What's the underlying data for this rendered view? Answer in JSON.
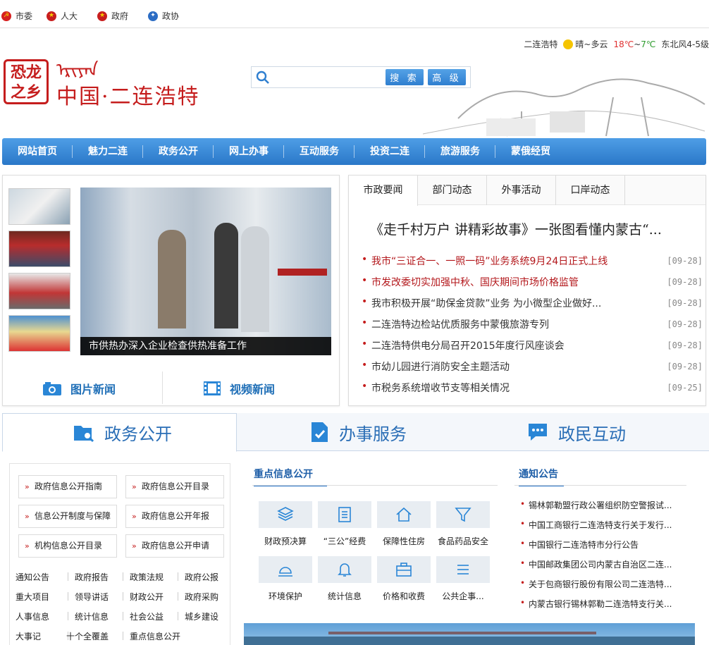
{
  "topbar": {
    "links": [
      "市委",
      "人大",
      "政府",
      "政协"
    ]
  },
  "logo": {
    "seal": "恐龙之乡",
    "mongolian": "ᠡᠷᠢᠶᠠᠨ",
    "title": "中国·二连浩特"
  },
  "search": {
    "placeholder": "",
    "search_label": "搜 索",
    "advanced_label": "高 级"
  },
  "weather": {
    "city": "二连浩特",
    "condition": "晴~多云",
    "temp_high": "18℃",
    "sep": "~",
    "temp_low": "7℃",
    "wind": "东北风4-5级"
  },
  "nav": {
    "items": [
      "网站首页",
      "魅力二连",
      "政务公开",
      "网上办事",
      "互动服务",
      "投资二连",
      "旅游服务",
      "蒙俄经贸"
    ]
  },
  "photo": {
    "caption": "市供热办深入企业检查供热准备工作",
    "photo_news_label": "图片新闻",
    "video_news_label": "视频新闻"
  },
  "news": {
    "tabs": [
      "市政要闻",
      "部门动态",
      "外事活动",
      "口岸动态"
    ],
    "headline": "《走千村万户 讲精彩故事》一张图看懂内蒙古“...",
    "items": [
      {
        "title": "我市“三证合一、一照一码”业务系统9月24日正式上线",
        "date": "[09-28]",
        "red": true
      },
      {
        "title": "市发改委切实加强中秋、国庆期间市场价格监管",
        "date": "[09-28]",
        "red": true
      },
      {
        "title": "我市积极开展“助保金贷款”业务 为小微型企业做好...",
        "date": "[09-28]",
        "red": false
      },
      {
        "title": "二连浩特边检站优质服务中蒙俄旅游专列",
        "date": "[09-28]",
        "red": false
      },
      {
        "title": "二连浩特供电分局召开2015年度行风座谈会",
        "date": "[09-28]",
        "red": false
      },
      {
        "title": "市幼儿园进行消防安全主题活动",
        "date": "[09-28]",
        "red": false
      },
      {
        "title": "市税务系统增收节支等相关情况",
        "date": "[09-25]",
        "red": false
      }
    ]
  },
  "bigtabs": [
    "政务公开",
    "办事服务",
    "政民互动"
  ],
  "gov": {
    "buttons": [
      "政府信息公开指南",
      "政府信息公开目录",
      "信息公开制度与保障",
      "政府信息公开年报",
      "机构信息公开目录",
      "政府信息公开申请"
    ],
    "links": [
      [
        "通知公告",
        "政府报告",
        "政策法规",
        "政府公报"
      ],
      [
        "重大项目",
        "领导讲话",
        "财政公开",
        "政府采购"
      ],
      [
        "人事信息",
        "统计信息",
        "社会公益",
        "城乡建设"
      ],
      [
        "大事记",
        "十个全覆盖",
        "重点信息公开"
      ]
    ]
  },
  "key": {
    "title": "重点信息公开",
    "items": [
      "财政预决算",
      "“三公”经费",
      "保障性住房",
      "食品药品安全",
      "环境保护",
      "统计信息",
      "价格和收费",
      "公共企事..."
    ]
  },
  "notices": {
    "title": "通知公告",
    "items": [
      "锡林郭勒盟行政公署组织防空警报试...",
      "中国工商银行二连浩特支行关于发行...",
      "中国银行二连浩特市分行公告",
      "中国邮政集团公司内蒙古自治区二连...",
      "关于包商银行股份有限公司二连浩特...",
      "内蒙古银行锡林郭勒二连浩特支行关..."
    ]
  }
}
